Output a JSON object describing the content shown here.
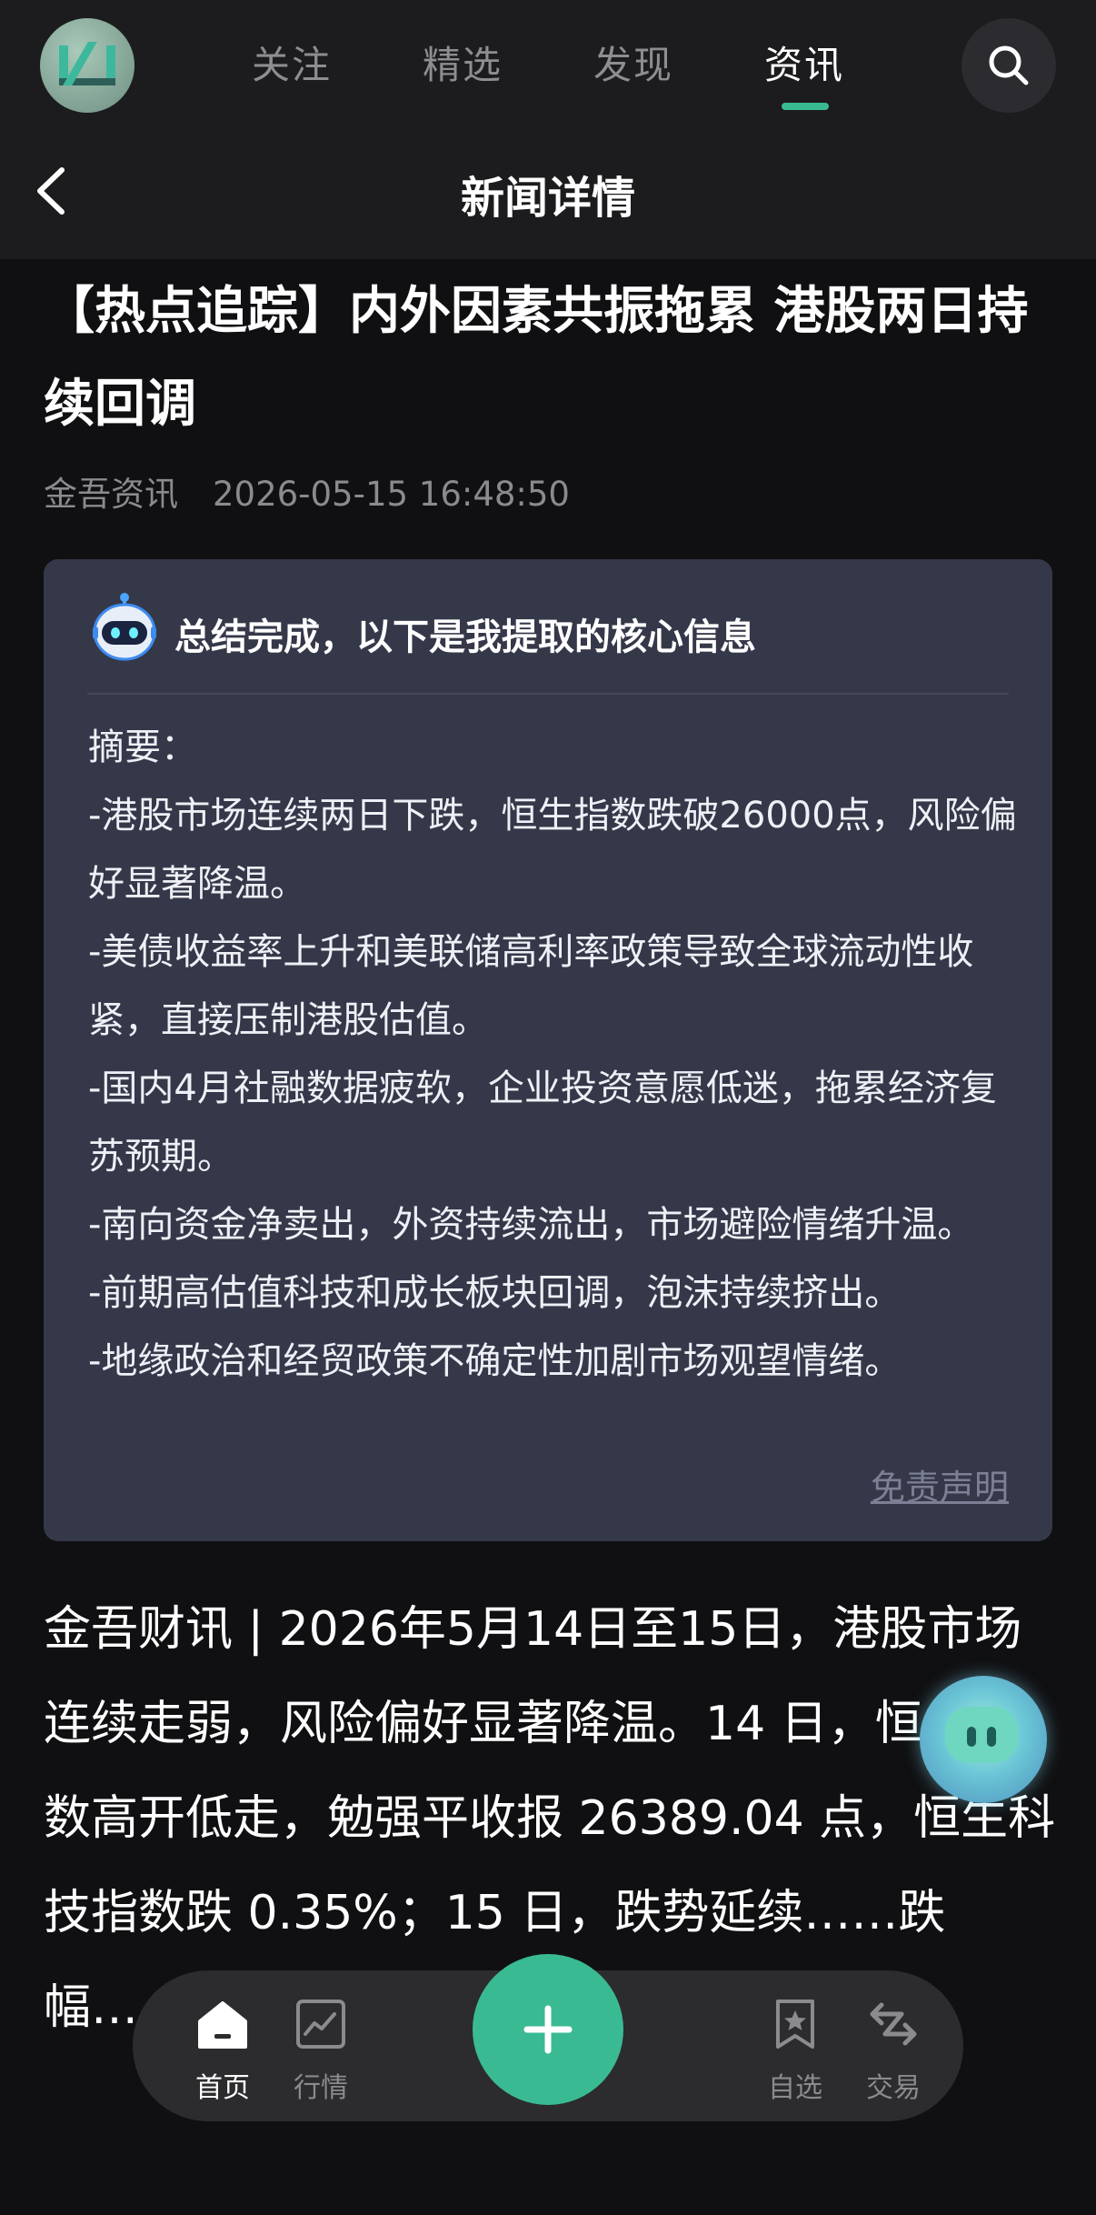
{
  "header": {
    "tabs": [
      {
        "label": "关注"
      },
      {
        "label": "精选"
      },
      {
        "label": "发现"
      },
      {
        "label": "资讯"
      }
    ],
    "active_tab": "资讯",
    "nav_title": "新闻详情"
  },
  "article": {
    "headline": "【热点追踪】内外因素共振拖累 港股两日持续回调",
    "source": "金吾资讯",
    "datetime": "2026-05-15 16:48:50",
    "summary_card": {
      "title": "总结完成，以下是我提取的核心信息",
      "lines": [
        "摘要：",
        "-港股市场连续两日下跌，恒生指数跌破26000点，风险偏好显著降温。",
        "-美债收益率上升和美联储高利率政策导致全球流动性收紧，直接压制港股估值。",
        "-国内4月社融数据疲软，企业投资意愿低迷，拖累经济复苏预期。",
        "-南向资金净卖出，外资持续流出，市场避险情绪升温。",
        "-前期高估值科技和成长板块回调，泡沫持续挤出。",
        "-地缘政治和经贸政策不确定性加剧市场观望情绪。"
      ],
      "disclaimer": "免责声明"
    },
    "body": "金吾财讯 | 2026年5月14日至15日，港股市场连续走弱，风险偏好显著降温。14 日，恒生指数高开低走，勉强平收报 26389.04 点，恒生科技指数跌 0.35%；15 日，跌势延续……跌幅……静。"
  },
  "bottom_nav": {
    "items": [
      {
        "label": "首页",
        "icon": "home-icon",
        "active": true
      },
      {
        "label": "行情",
        "icon": "market-chart-icon",
        "active": false
      },
      {
        "label": "自选",
        "icon": "bookmark-star-icon",
        "active": false
      },
      {
        "label": "交易",
        "icon": "trade-arrows-icon",
        "active": false
      }
    ],
    "fab_icon": "plus-icon"
  },
  "colors": {
    "accent": "#3aba93",
    "background": "#101012",
    "header_bg": "#1c1c1e",
    "card_bg": "#353849"
  }
}
